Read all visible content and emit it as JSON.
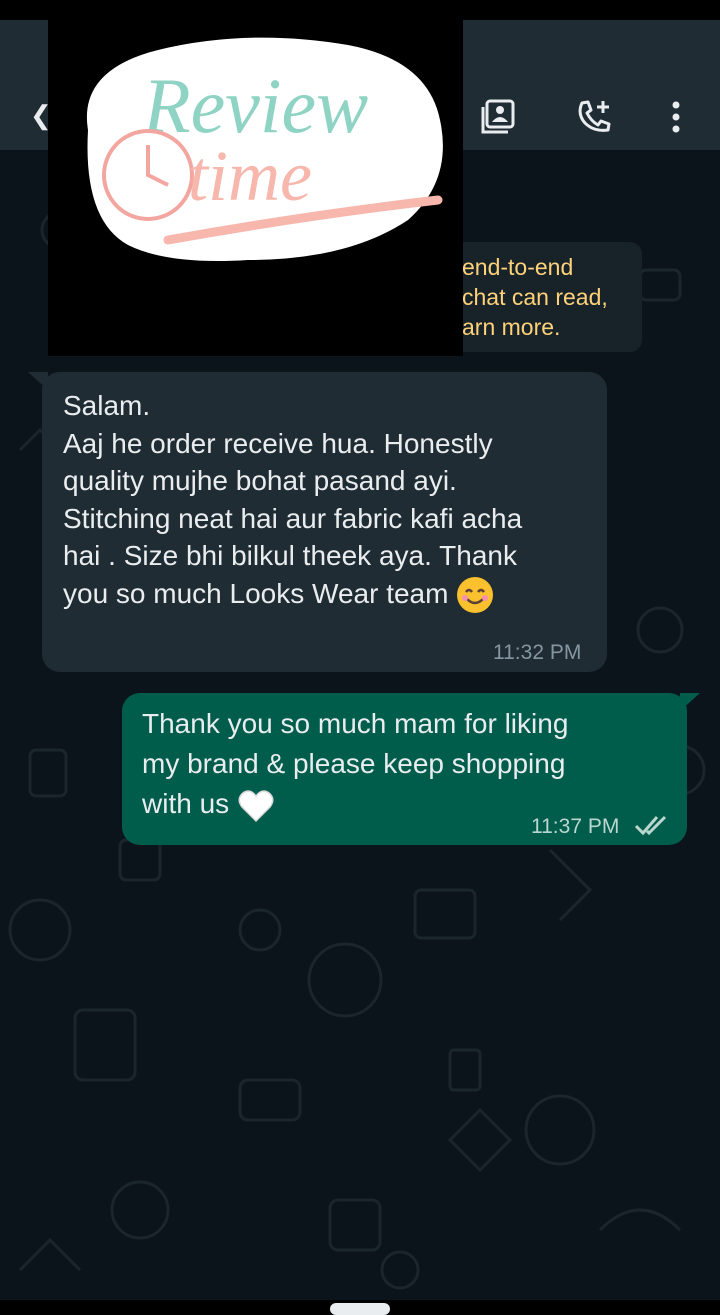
{
  "header": {
    "back_icon": "back-arrow-icon",
    "actions": [
      "contact-card-icon",
      "add-call-icon",
      "more-vert-icon"
    ]
  },
  "sticker": {
    "line1": "Review",
    "line2": "time"
  },
  "notice": {
    "text": "end-to-end\nchat can read,\narn more."
  },
  "messages": [
    {
      "direction": "incoming",
      "text": "Salam.\nAaj he order receive hua. Honestly\nquality mujhe bohat pasand ayi.\nStitching neat hai aur fabric kafi acha\nhai . Size bhi bilkul theek aya. Thank\nyou so much Looks Wear team ",
      "emoji": "smiling-face-icon",
      "time": "11:32 PM"
    },
    {
      "direction": "outgoing",
      "text": "Thank you so much mam for liking\nmy brand & please keep shopping\nwith us ",
      "emoji": "white-heart-icon",
      "time": "11:37 PM",
      "status": "read"
    }
  ],
  "colors": {
    "app_bar": "#1f2c34",
    "background": "#0b141a",
    "incoming_bubble": "#202c33",
    "outgoing_bubble": "#005c4b",
    "notice_text": "#ffd279"
  }
}
